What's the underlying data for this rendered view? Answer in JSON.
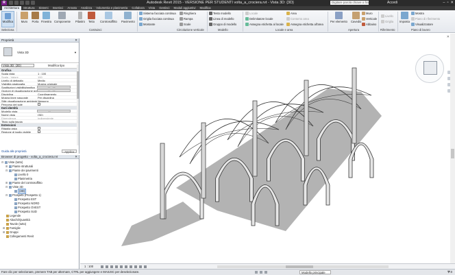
{
  "titlebar": {
    "title": "Autodesk Revit 2015 - VERSIONE PER STUDENTI    volta_a_crociera.rvt - Vista 3D: {3D}",
    "search_placeholder": "Digitare parola chiave o frase",
    "access": "Accedi",
    "controls": [
      "–",
      "▫",
      "✕"
    ]
  },
  "tabs": [
    "Architettura",
    "Struttura",
    "Sistemi",
    "Inserisci",
    "Annota",
    "Analizza",
    "Volumetria e planimetria",
    "Collabora",
    "Vista",
    "Gestisci",
    "Moduli aggiuntivi",
    "Modifica"
  ],
  "ribbon": {
    "buttons": [
      "Modifica",
      "Muro",
      "Porta",
      "Finestra",
      "Componente",
      "Pilastro",
      "Tetto",
      "Controsoffitto",
      "Pavimento"
    ],
    "facade": [
      "Sistema facciata continua",
      "Griglia facciata continua",
      "Montante"
    ],
    "railing": [
      "Ringhiera",
      "Rampa",
      "Scale"
    ],
    "model": [
      "Testo modello",
      "Linea di modello",
      "Gruppo di modello"
    ],
    "room": [
      "Locale",
      "Delimitatore locale",
      "Assegna etichetta al locale"
    ],
    "area": [
      "Area",
      "Contorno area",
      "Assegna etichetta all'area"
    ],
    "opening": [
      "Per elemento",
      "Cavedio",
      "Muro",
      "Verticale",
      "Abbaino"
    ],
    "datum": [
      "Livello",
      "Griglia"
    ],
    "workplane": [
      "Mostra",
      "Piano di riferimento",
      "Visualizzatore",
      "Imposta"
    ],
    "panels": [
      "Seleziona",
      "Costruisci",
      "Circolazione verticale",
      "Modello",
      "Locale e area",
      "Apertura",
      "Riferimento",
      "Piano di lavoro"
    ]
  },
  "properties": {
    "header": "Proprietà",
    "type_name": "Vista 3D",
    "view_select": "Vista 3D: {3D}",
    "edit_type": "Modifica tipo",
    "groups": [
      {
        "name": "Grafica",
        "rows": [
          {
            "k": "Scala vista",
            "v": "1 : 100"
          },
          {
            "k": "Scala - Valore",
            "v": "100",
            "dim": true
          },
          {
            "k": "Livello di dettaglio",
            "v": "Medio"
          },
          {
            "k": "Visibilità stratigrafia",
            "v": "Mostra originale"
          },
          {
            "k": "Sostituzioni visibilità/grafica",
            "v": "Modifica...",
            "btn": true
          },
          {
            "k": "Opzioni di visualizzazione grafica",
            "v": "Modifica...",
            "btn": true
          },
          {
            "k": "Disciplina",
            "v": "Coordinamento"
          },
          {
            "k": "Mostra linee nascoste",
            "v": "Per disciplina"
          },
          {
            "k": "Stile visualizzazione ambiente",
            "v": "Nessuno"
          },
          {
            "k": "Percorso del sole",
            "v": "",
            "chk": true
          }
        ]
      },
      {
        "name": "Dati identità",
        "rows": [
          {
            "k": "Modello vista",
            "v": "<Nessuno>",
            "btn": true
          },
          {
            "k": "Nome vista",
            "v": "{3D}"
          },
          {
            "k": "Dipendenza",
            "v": "Indipendente",
            "dim": true
          },
          {
            "k": "Titolo sulla tavola",
            "v": ""
          }
        ]
      },
      {
        "name": "Estensioni",
        "rows": [
          {
            "k": "Ritaglia vista",
            "v": "",
            "chk": true
          },
          {
            "k": "Regione di taglio visibile",
            "v": "",
            "chk": true
          }
        ]
      }
    ],
    "help_link": "Guida alle proprietà",
    "apply": "Applica"
  },
  "browser": {
    "header": "Browser di progetto - volta_a_crociera.rvt",
    "items": [
      {
        "label": "Viste (tutto)",
        "toggle": "⊟"
      },
      {
        "label": "Piante strutturali",
        "toggle": "⊞"
      },
      {
        "label": "Piante dei pavimenti",
        "toggle": "⊟"
      },
      {
        "label": "Livello 0",
        "toggle": ""
      },
      {
        "label": "Planimetria",
        "toggle": ""
      },
      {
        "label": "Piante del controsoffitto",
        "toggle": "⊞"
      },
      {
        "label": "Viste 3D",
        "toggle": "⊟"
      },
      {
        "label": "{3D}",
        "toggle": "",
        "selected": true
      },
      {
        "label": "Prospetti (Prospetto 1)",
        "toggle": "⊟"
      },
      {
        "label": "Prospetto EST",
        "toggle": ""
      },
      {
        "label": "Prospetto NORD",
        "toggle": ""
      },
      {
        "label": "Prospetto OVEST",
        "toggle": ""
      },
      {
        "label": "Prospetto SUD",
        "toggle": ""
      },
      {
        "label": "Legende",
        "toggle": ""
      },
      {
        "label": "Abachi/Quantità",
        "toggle": ""
      },
      {
        "label": "Tavole (tutto)",
        "toggle": ""
      },
      {
        "label": "Famiglie",
        "toggle": "⊞"
      },
      {
        "label": "Gruppi",
        "toggle": "⊞"
      },
      {
        "label": "Collegamenti Revit",
        "toggle": ""
      }
    ]
  },
  "viewctl": {
    "scale": "1 : 100"
  },
  "statusbar": {
    "message": "Fare clic per selezionare, premere TAB per alternare, CTRL per aggiungere e MAIUSC per deselezionare.",
    "model": "Modello principale",
    "filter": ":0"
  },
  "colors": {
    "titlebar": "#2b2b2b",
    "accent": "#1a4fa0",
    "shadow": "#b3b3b3"
  }
}
